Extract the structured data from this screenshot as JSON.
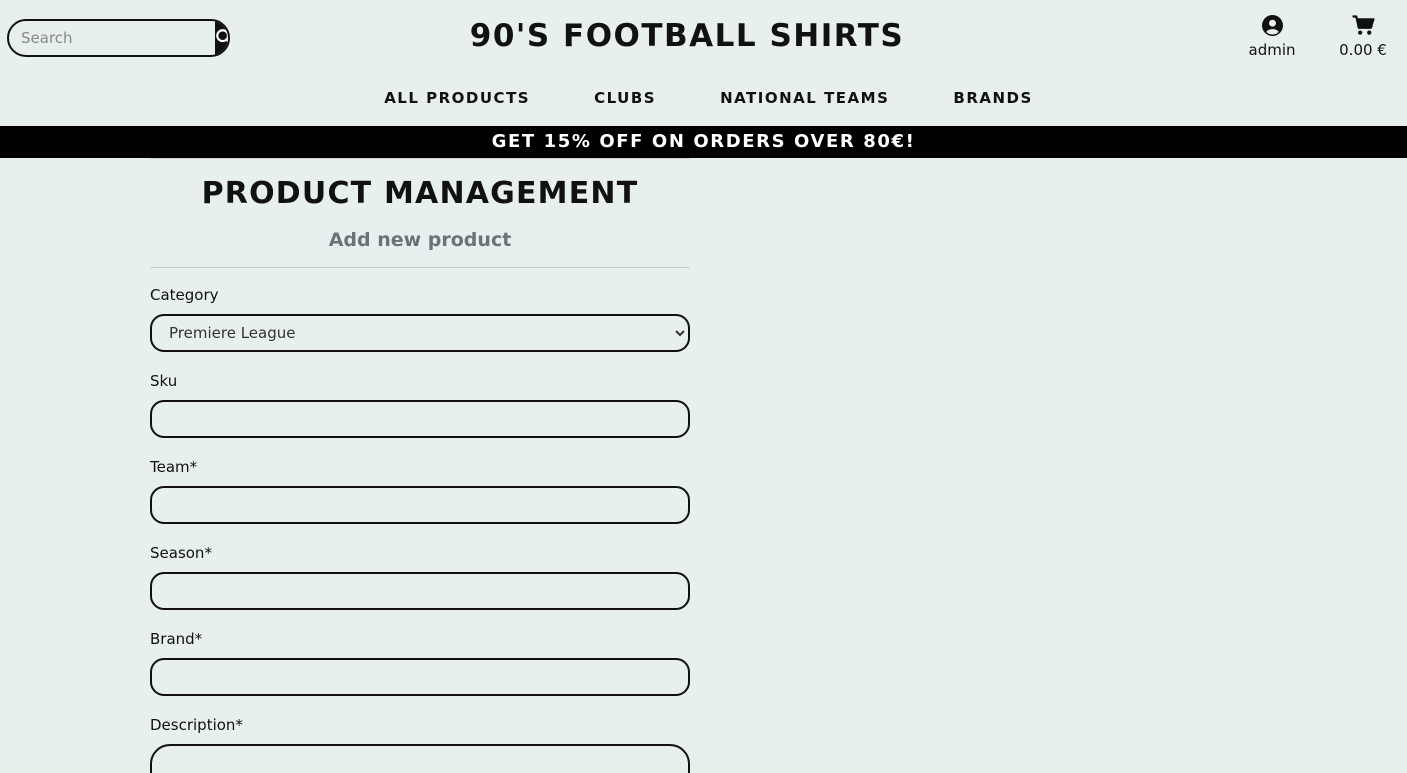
{
  "header": {
    "search": {
      "placeholder": "Search"
    },
    "title": "90'S FOOTBALL SHIRTS",
    "account": {
      "icon": "user-circle-icon",
      "label": "admin"
    },
    "cart": {
      "icon": "shopping-cart-icon",
      "total": "0.00 €"
    }
  },
  "nav": {
    "items": [
      {
        "label": "ALL PRODUCTS"
      },
      {
        "label": "CLUBS"
      },
      {
        "label": "NATIONAL TEAMS"
      },
      {
        "label": "BRANDS"
      }
    ]
  },
  "promo": {
    "text": "GET 15% OFF ON ORDERS OVER 80€!"
  },
  "management": {
    "title": "PRODUCT MANAGEMENT",
    "subtitle": "Add new product",
    "fields": {
      "category": {
        "label": "Category",
        "value": "Premiere League"
      },
      "sku": {
        "label": "Sku",
        "value": ""
      },
      "team": {
        "label": "Team*",
        "value": ""
      },
      "season": {
        "label": "Season*",
        "value": ""
      },
      "brand": {
        "label": "Brand*",
        "value": ""
      },
      "description": {
        "label": "Description*",
        "value": ""
      }
    }
  },
  "colors": {
    "background": "#e7efef",
    "primary": "#111111",
    "promo_bg": "#000000",
    "subtitle": "#6b7378"
  }
}
